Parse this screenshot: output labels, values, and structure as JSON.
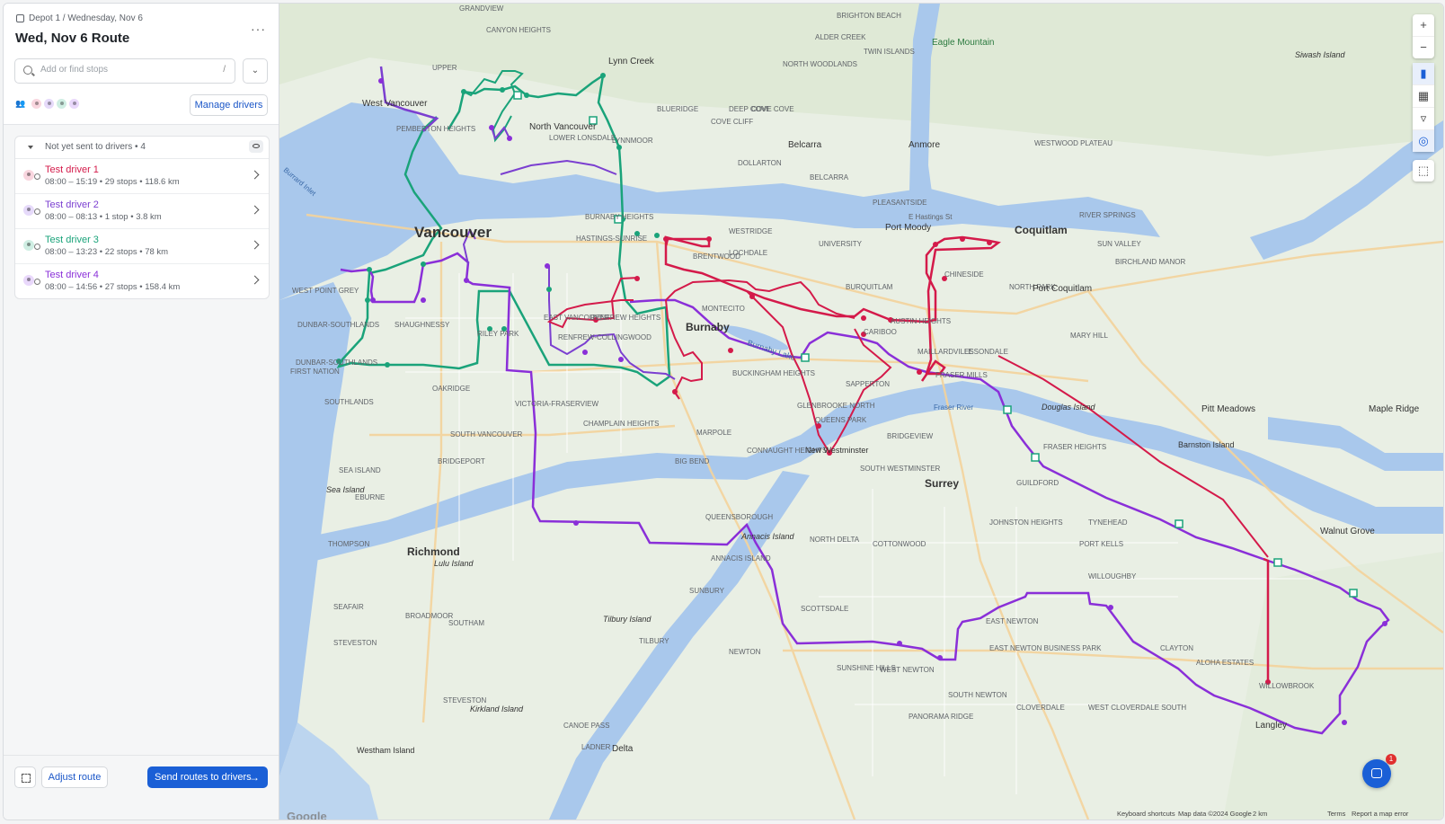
{
  "sidebar": {
    "breadcrumb": "Depot 1 / Wednesday, Nov 6",
    "title": "Wed, Nov 6 Route",
    "more": "···",
    "search": {
      "placeholder": "Add or find stops",
      "shortcut": "/"
    },
    "manage_label": "Manage drivers",
    "group": {
      "label": "Not yet sent to drivers • 4"
    },
    "drivers": [
      {
        "name": "Test driver 1",
        "meta": "08:00 – 15:19 • 29 stops • 118.6 km",
        "color": "#d41a4a",
        "light": "#f9d6df"
      },
      {
        "name": "Test driver 2",
        "meta": "08:00 – 08:13 • 1 stop • 3.8 km",
        "color": "#7b3fd0",
        "light": "#e6dafa"
      },
      {
        "name": "Test driver 3",
        "meta": "08:00 – 13:23 • 22 stops • 78 km",
        "color": "#1aa37a",
        "light": "#cfeee3"
      },
      {
        "name": "Test driver 4",
        "meta": "08:00 – 14:56 • 27 stops • 158.4 km",
        "color": "#8a2fd8",
        "light": "#e9d8fb"
      }
    ],
    "adjust_label": "Adjust route",
    "send_label": "Send routes to drivers",
    "send_arrow": "→"
  },
  "map": {
    "controls": {
      "zoom_in": "+",
      "zoom_out": "−"
    },
    "labels": [
      {
        "t": "Vancouver",
        "big": true
      },
      {
        "t": "Burnaby",
        "big": true
      },
      {
        "t": "Surrey",
        "big": true
      },
      {
        "t": "Richmond",
        "big": true
      },
      {
        "t": "Coquitlam",
        "big": true
      },
      {
        "t": "Port Coquitlam"
      },
      {
        "t": "Port Moody"
      },
      {
        "t": "North Vancouver"
      },
      {
        "t": "West Vancouver"
      },
      {
        "t": "Lynn Creek"
      },
      {
        "t": "Belcarra"
      },
      {
        "t": "Anmore"
      },
      {
        "t": "Eagle Mountain"
      },
      {
        "t": "Pitt Meadows"
      },
      {
        "t": "Maple Ridge"
      },
      {
        "t": "Walnut Grove"
      },
      {
        "t": "Barnston Island"
      },
      {
        "t": "Douglas Island"
      },
      {
        "t": "Langley"
      },
      {
        "t": "Delta"
      },
      {
        "t": "Westham Island"
      },
      {
        "t": "Kirkland Island"
      },
      {
        "t": "Tilbury Island"
      },
      {
        "t": "Lulu Island"
      },
      {
        "t": "Sea Island"
      },
      {
        "t": "Annacis Island"
      },
      {
        "t": "New Westminster"
      },
      {
        "t": "Burnaby Lake"
      },
      {
        "t": "Siwash Island"
      },
      {
        "t": "Burrard Inlet"
      },
      {
        "t": "Fraser River"
      }
    ],
    "attribution": {
      "logo": "Google",
      "shortcuts": "Keyboard shortcuts",
      "data": "Map data ©2024 Google",
      "scale": "2 km",
      "terms": "Terms",
      "report": "Report a map error"
    },
    "chat_badge": "1"
  }
}
